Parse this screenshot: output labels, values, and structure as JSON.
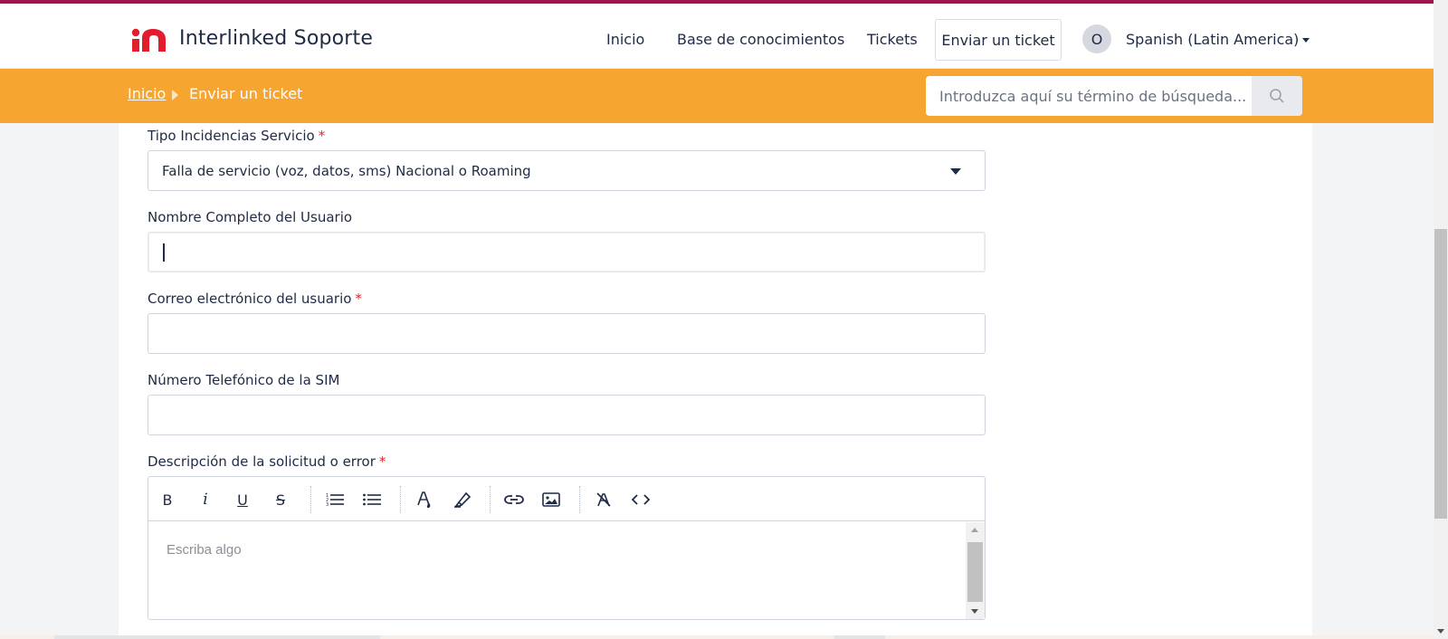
{
  "header": {
    "brand": "Interlinked Soporte",
    "nav": [
      "Inicio",
      "Base de conocimientos",
      "Tickets"
    ],
    "submit_ticket": "Enviar un ticket",
    "avatar_initial": "O",
    "language": "Spanish (Latin America)"
  },
  "breadcrumb": {
    "home": "Inicio",
    "current": "Enviar un ticket"
  },
  "search": {
    "placeholder": "Introduzca aquí su término de búsqueda..."
  },
  "form": {
    "incident_type": {
      "label": "Tipo Incidencias Servicio",
      "required": "*",
      "value": "Falla de servicio (voz, datos, sms) Nacional o Roaming"
    },
    "full_name": {
      "label": "Nombre Completo del Usuario",
      "value": ""
    },
    "email": {
      "label": "Correo electrónico del usuario",
      "required": "*",
      "value": ""
    },
    "sim_phone": {
      "label": "Número Telefónico de la SIM",
      "value": ""
    },
    "description": {
      "label": "Descripción de la solicitud o error",
      "required": "*",
      "placeholder": "Escriba algo",
      "toolbar": {
        "bold": "B",
        "italic": "i",
        "underline": "U",
        "strikethrough": "S"
      }
    }
  },
  "colors": {
    "brand_accent": "#a0154c",
    "band": "#f7a531",
    "required": "#d32f2f",
    "text": "#1f2a44"
  }
}
